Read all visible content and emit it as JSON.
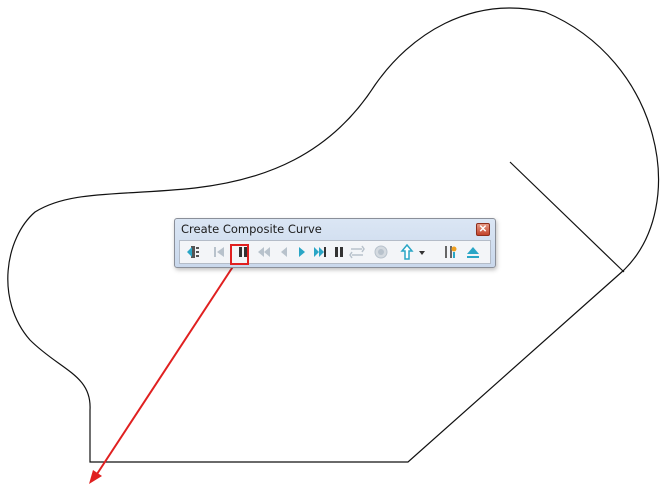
{
  "window": {
    "title": "Create Composite Curve",
    "close_symbol": "✕"
  },
  "toolbar": {
    "buttons": [
      {
        "name": "exit-sketch-icon",
        "enabled": true
      },
      {
        "name": "step-to-start-icon",
        "enabled": false
      },
      {
        "name": "pause-icon",
        "enabled": true,
        "highlighted": true
      },
      {
        "name": "rewind-icon",
        "enabled": false
      },
      {
        "name": "step-back-icon",
        "enabled": false
      },
      {
        "name": "play-icon",
        "enabled": true
      },
      {
        "name": "fast-forward-icon",
        "enabled": true
      },
      {
        "name": "pause-secondary-icon",
        "enabled": true
      },
      {
        "name": "swap-direction-icon",
        "enabled": false
      },
      {
        "name": "record-icon",
        "enabled": false
      },
      {
        "name": "up-arrow-icon",
        "enabled": true
      },
      {
        "name": "dropdown-arrow-icon",
        "enabled": true
      },
      {
        "name": "options-icon",
        "enabled": true
      },
      {
        "name": "eject-icon",
        "enabled": true
      }
    ]
  },
  "colors": {
    "accent": "#2aa6c6",
    "disabled": "#b8c2cc",
    "annotation": "#e02020",
    "curve": "#111111"
  }
}
